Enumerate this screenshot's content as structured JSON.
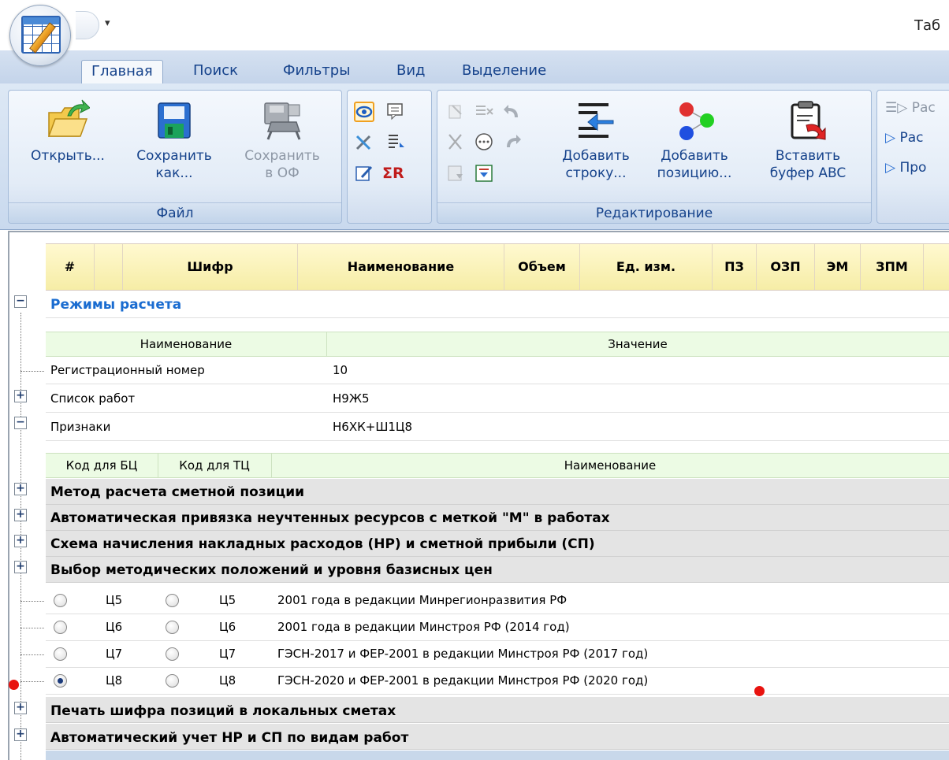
{
  "window": {
    "title_fragment": "Таб"
  },
  "qat": {
    "dropdown_glyph": "▾"
  },
  "ribbon": {
    "tabs": [
      "Главная",
      "Поиск",
      "Фильтры",
      "Вид",
      "Выделение"
    ],
    "active_tab": "Главная",
    "groups": {
      "file": {
        "label": "Файл",
        "open": {
          "line1": "Открыть...",
          "line2": ""
        },
        "save_as": {
          "line1": "Сохранить",
          "line2": "как..."
        },
        "save_of": {
          "line1": "Сохранить",
          "line2": "в ОФ"
        }
      },
      "edit": {
        "label": "Редактирование",
        "add_row": {
          "line1": "Добавить",
          "line2": "строку..."
        },
        "add_position": {
          "line1": "Добавить",
          "line2": "позицию..."
        },
        "paste_abc": {
          "line1": "Вставить",
          "line2": "буфер ABC"
        },
        "sum_glyph": "ΣR"
      },
      "calc": {
        "item1": "Рас",
        "item2": "Рас",
        "item3": "Про"
      }
    }
  },
  "grid": {
    "columns": [
      "#",
      "",
      "Шифр",
      "Наименование",
      "Объем",
      "Ед. изм.",
      "ПЗ",
      "ОЗП",
      "ЭМ",
      "ЗПМ"
    ]
  },
  "section": {
    "title": "Режимы расчета",
    "props_header": {
      "name": "Наименование",
      "value": "Значение"
    },
    "props": [
      {
        "name": "Регистрационный номер",
        "value": "10"
      },
      {
        "name": "Список работ",
        "value": "Н9Ж5"
      },
      {
        "name": "Признаки",
        "value": "Н6ХК+Ш1Ц8"
      }
    ],
    "flags_header": {
      "bc": "Код для БЦ",
      "tc": "Код для ТЦ",
      "name": "Наименование"
    },
    "groups_top": [
      "Метод расчета сметной позиции",
      "Автоматическая привязка неучтенных ресурсов с меткой \"М\" в работах",
      "Схема начисления накладных расходов (НР) и сметной прибыли (СП)",
      "Выбор методических положений и уровня базисных цен"
    ],
    "options": [
      {
        "bc": "Ц5",
        "tc": "Ц5",
        "name": "2001 года в редакции Минрегионразвития РФ",
        "checked": false
      },
      {
        "bc": "Ц6",
        "tc": "Ц6",
        "name": "2001 года в редакции Минстроя РФ (2014 год)",
        "checked": false
      },
      {
        "bc": "Ц7",
        "tc": "Ц7",
        "name": "ГЭСН-2017 и ФЕР-2001 в редакции Минстроя РФ (2017 год)",
        "checked": false
      },
      {
        "bc": "Ц8",
        "tc": "Ц8",
        "name": "ГЭСН-2020 и ФЕР-2001 в редакции Минстроя РФ (2020 год)",
        "checked": true
      }
    ],
    "groups_bottom": [
      "Печать шифра позиций в локальных сметах",
      "Автоматический учет НР и СП по видам работ"
    ]
  },
  "colors": {
    "accent_blue": "#1a6cd0",
    "ribbon_text": "#15428b",
    "marker_red": "#e8130f"
  }
}
